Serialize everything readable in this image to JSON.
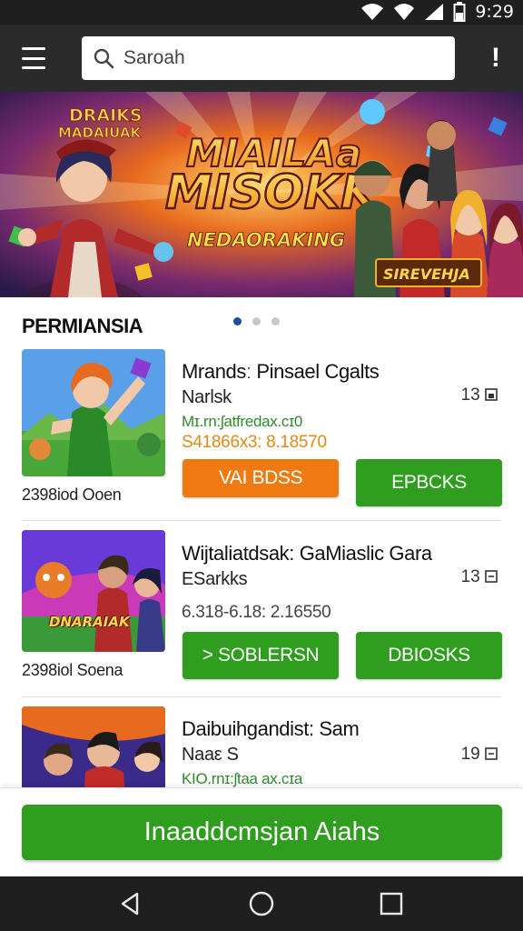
{
  "status_bar": {
    "time": "9:29"
  },
  "app_bar": {
    "search_placeholder": "Saroah"
  },
  "banner": {
    "title_line1": "MIAILAa",
    "title_line2": "MISOKK",
    "subtitle": "NEDAORAKING",
    "badge": "SIREVEHJA",
    "corner_logo_line1": "DRAIKS",
    "corner_logo_line2": "MADAIUAK"
  },
  "section": {
    "title": "PERMIANSIA",
    "carousel_dots": 3,
    "active_dot": 0
  },
  "games": [
    {
      "title": "Mrandsː Pinsael Cgalts",
      "subtitle": "Narlsk",
      "size": "13",
      "developer": "Mɪ.rn:ʃatfredax.cɪ0",
      "price": "S41866x3: 8.18570",
      "thumb_caption": "2398iod Ooen",
      "button_left": "VAI BDSS",
      "button_left_color": "#f07a12",
      "button_right": "EPBCKS",
      "thumb_logo": ""
    },
    {
      "title": "Wijtaliatdsak: GaMiaslic Gara",
      "subtitle": "ESarkks",
      "size": "13",
      "developer": "",
      "price": "6.318-6.18: 2.16550",
      "thumb_caption": "2398iol Soena",
      "button_left": "> SOBLERSN",
      "button_left_color": "#2f9e1f",
      "button_right": "DBIOSKS",
      "thumb_logo": "DNARAIAK"
    },
    {
      "title": "Daibuihgandist: Sam",
      "subtitle": "Naaε S",
      "size": "19",
      "developer": "KIO.rnɪ:ʃtaa ax.cɪa",
      "price": "",
      "thumb_caption": "",
      "button_left": "",
      "button_left_color": "",
      "button_right": "",
      "thumb_logo": ""
    }
  ],
  "cta": {
    "label": "Inaaddcmsjan Aiahs"
  },
  "colors": {
    "accent_green": "#2f9e1f",
    "accent_orange": "#f07a12",
    "app_bar": "#2b2b2b",
    "dot_active": "#1e4f9c"
  },
  "icons": [
    "wifi-icon",
    "signal-icon",
    "battery-icon",
    "menu-icon",
    "search-icon",
    "info-icon",
    "nav-back-icon",
    "nav-home-icon",
    "nav-recents-icon"
  ]
}
